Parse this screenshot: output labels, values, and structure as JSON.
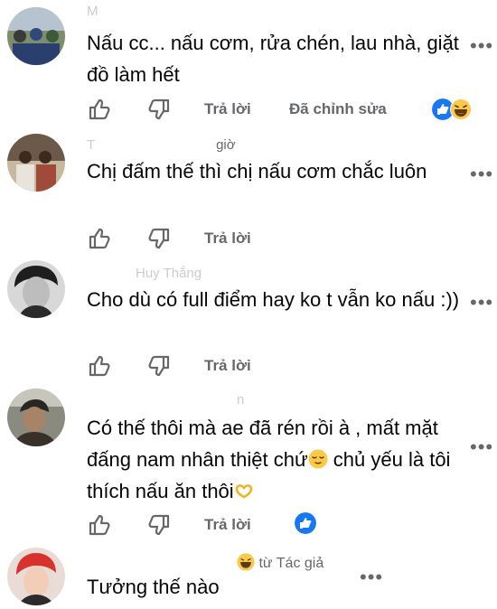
{
  "comments": [
    {
      "author": "M",
      "text": "Nấu cc... nấu cơm, rửa chén, lau nhà, giặt đồ làm hết",
      "reply_label": "Trả lời",
      "edited_label": "Đã chỉnh sửa",
      "reactions": [
        "like",
        "haha"
      ]
    },
    {
      "author": "T",
      "time": "giờ",
      "text": "Chị đấm thế thì chị nấu cơm chắc luôn",
      "reply_label": "Trả lời"
    },
    {
      "author": "Huy Thắng",
      "text": "Cho dù có full điểm hay ko t vẫn ko nấu :))",
      "reply_label": "Trả lời"
    },
    {
      "author": "n",
      "text_part1": "Có thế thôi mà ae đã rén rồi à , mất mặt đấng nam nhân thiệt chứ",
      "text_part2": " chủ yếu là tôi thích nấu ăn thôi",
      "reply_label": "Trả lời",
      "reactions": [
        "like"
      ]
    },
    {
      "author": "",
      "badge": "từ Tác giả",
      "text": "Tưởng thế nào"
    }
  ],
  "more_label": "•••",
  "colors": {
    "like_blue": "#1877f2",
    "meta_gray": "#65676b",
    "emoji_yellow": "#fbc94a"
  }
}
